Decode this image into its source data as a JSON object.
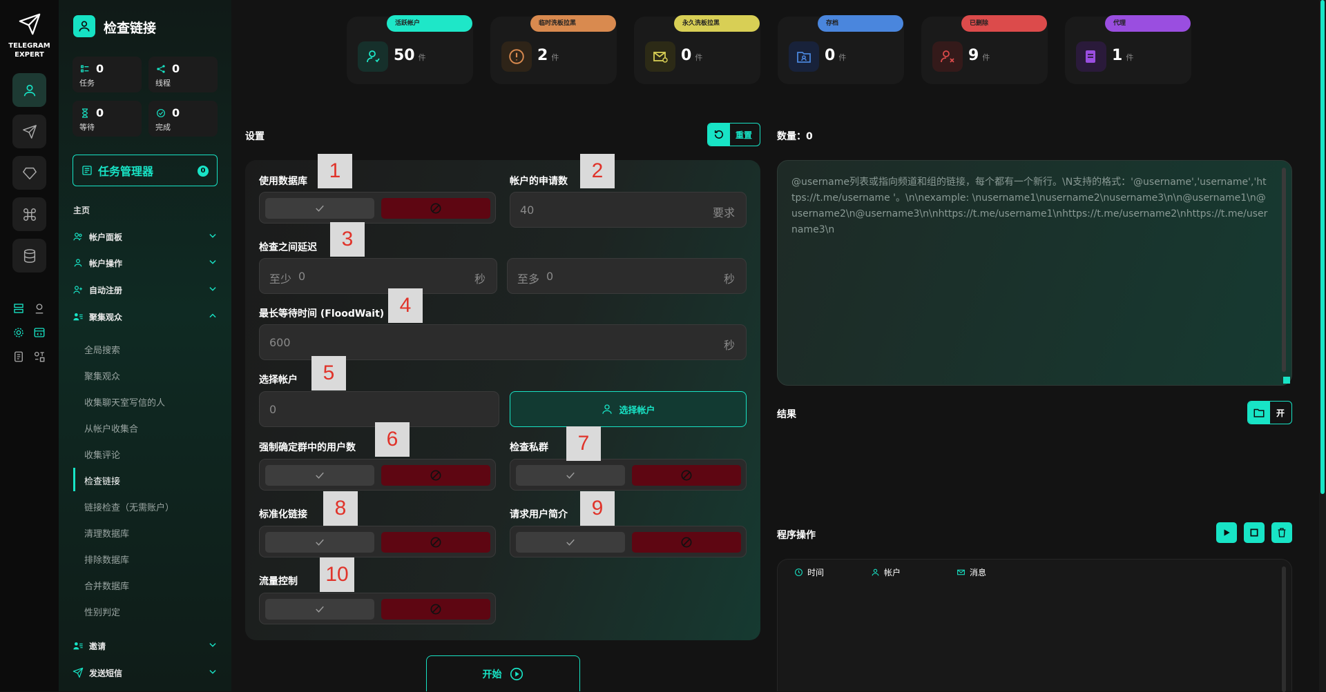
{
  "app": {
    "logo_line1": "TELEGRAM",
    "logo_line2": "EXPERT",
    "page_title": "检查链接"
  },
  "stats": [
    {
      "value": "0",
      "label": "任务"
    },
    {
      "value": "0",
      "label": "线程"
    },
    {
      "value": "0",
      "label": "等待"
    },
    {
      "value": "0",
      "label": "完成"
    }
  ],
  "task_manager": {
    "label": "任务管理器",
    "count": "0"
  },
  "nav": {
    "section": "主页",
    "groups": {
      "accounts_panel": "帐户面板",
      "account_ops": "帐户操作",
      "auto_register": "自动注册",
      "audience": "聚集观众",
      "invite": "邀请",
      "send_sms": "发送短信"
    },
    "sub_items": [
      "全局搜索",
      "聚集观众",
      "收集聊天室写信的人",
      "从帐户收集合",
      "收集评论",
      "检查链接",
      "链接检查（无需账户）",
      "清理数据库",
      "排除数据库",
      "合并数据库",
      "性别判定"
    ]
  },
  "kpis": [
    {
      "tag": "活跃帐户",
      "value": "50",
      "unit": "件",
      "color": "#1ee7c8"
    },
    {
      "tag": "临时洗板拉黑",
      "value": "2",
      "unit": "件",
      "color": "#d98a4f"
    },
    {
      "tag": "永久洗板拉黑",
      "value": "0",
      "unit": "件",
      "color": "#d8cf55"
    },
    {
      "tag": "存档",
      "value": "0",
      "unit": "件",
      "color": "#4a86dd"
    },
    {
      "tag": "已删除",
      "value": "9",
      "unit": "件",
      "color": "#dc4b4b"
    },
    {
      "tag": "代理",
      "value": "1",
      "unit": "件",
      "color": "#9a4ee0"
    }
  ],
  "settings": {
    "title": "设置",
    "reset": "重置",
    "use_db": "使用数据库",
    "account_requests": "帐户的申请数",
    "account_requests_value": "40",
    "account_requests_unit": "要求",
    "delay_label": "检查之间延迟",
    "delay_min_ph": "至少",
    "delay_min_val": "0",
    "delay_max_ph": "至多",
    "delay_max_val": "0",
    "sec_unit": "秒",
    "floodwait_label": "最长等待时间 (FloodWait)",
    "floodwait_value": "600",
    "select_account_label": "选择帐户",
    "select_account_value": "0",
    "select_account_btn": "选择帐户",
    "force_count": "强制确定群中的用户数",
    "check_private": "检查私群",
    "normalize_links": "标准化链接",
    "request_bio": "请求用户简介",
    "traffic_control": "流量控制",
    "start": "开始"
  },
  "markers": [
    "1",
    "2",
    "3",
    "4",
    "5",
    "6",
    "7",
    "8",
    "9",
    "10"
  ],
  "right": {
    "count_label": "数量：0",
    "textarea_placeholder": "@username列表或指向频道和组的链接，每个都有一个新行。\\N支持的格式：'@username','username','https://t.me/username '。\\n\\nexample: \\nusername1\\nusername2\\nusername3\\n\\n@username1\\n@username2\\n@username3\\n\\nhttps://t.me/username1\\nhttps://t.me/username2\\nhttps://t.me/username3\\n",
    "results_label": "结果",
    "open_btn": "开",
    "program_ops": "程序操作",
    "col_time": "时间",
    "col_account": "帐户",
    "col_message": "消息"
  }
}
